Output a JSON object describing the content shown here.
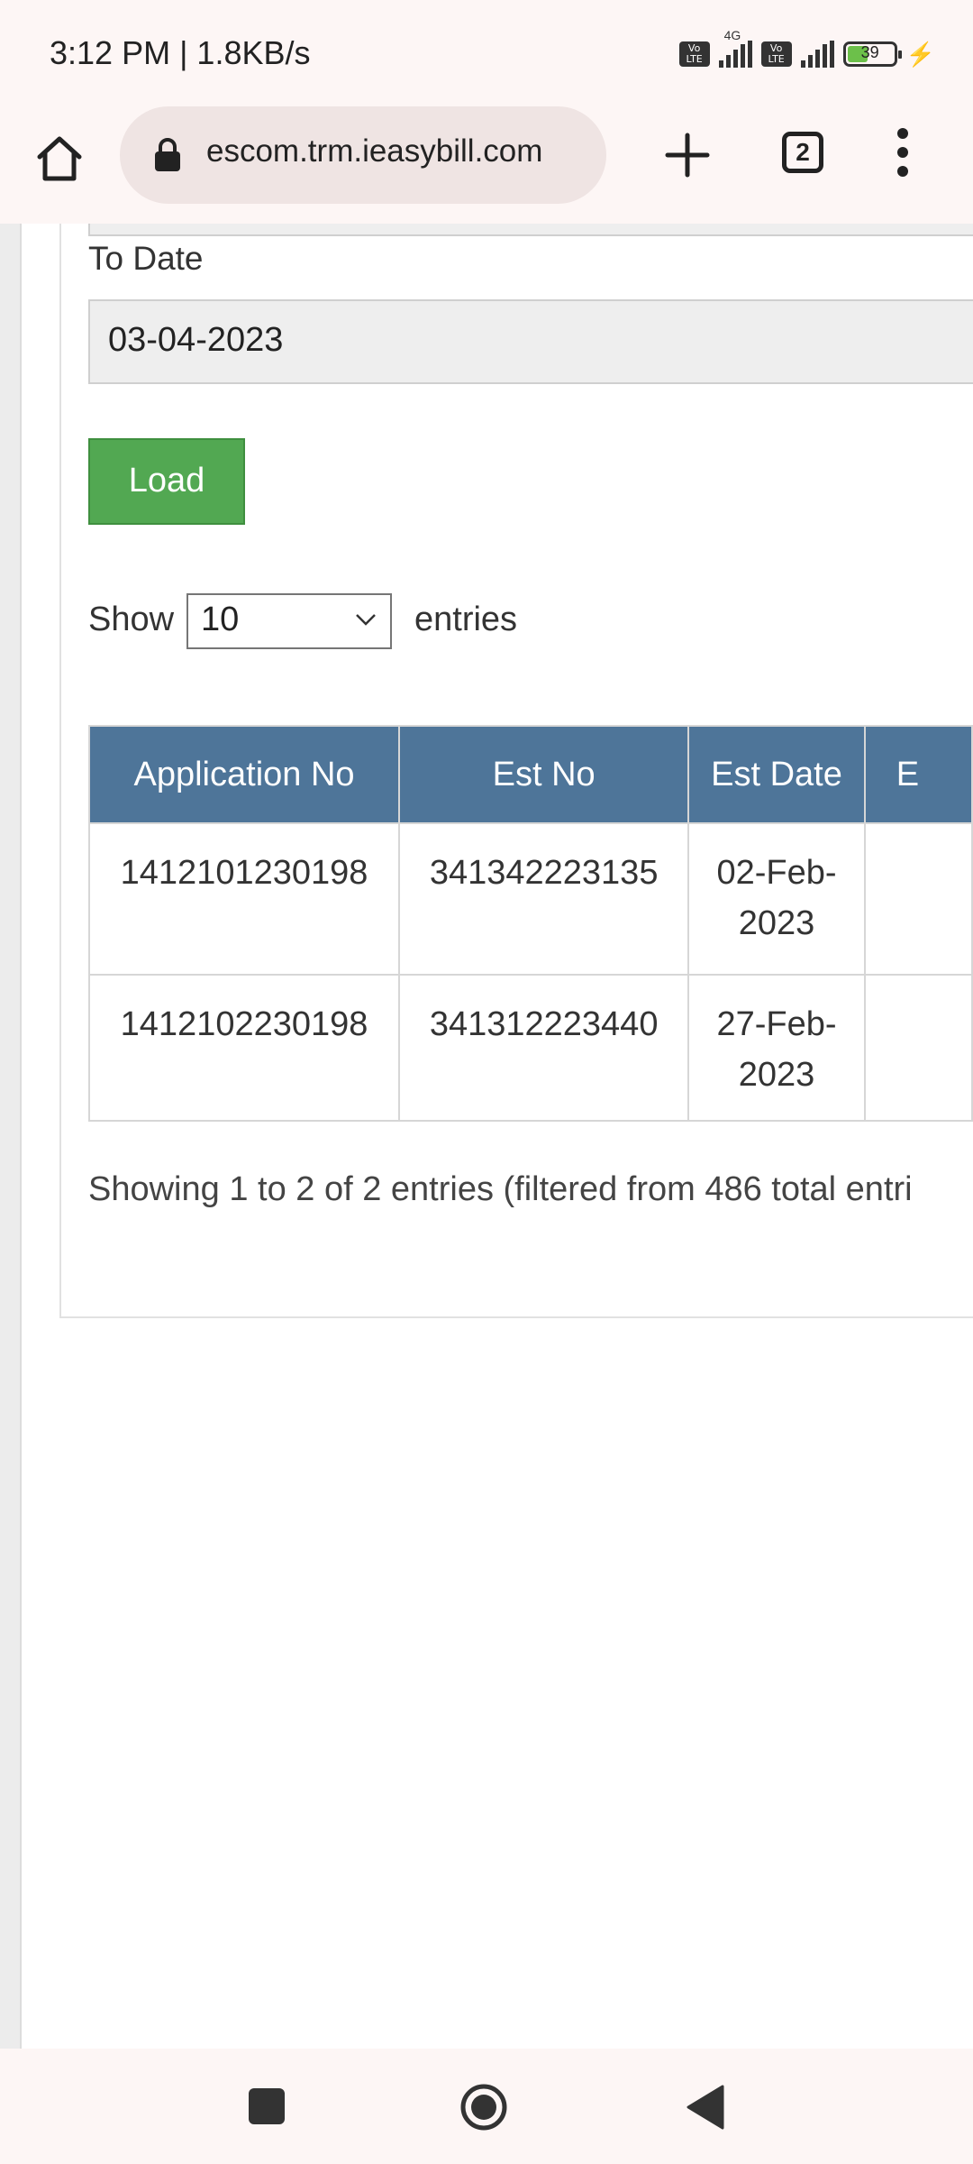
{
  "status_bar": {
    "time": "3:12 PM | 1.8KB/s",
    "network": "4G",
    "volte_label": "Vo LTE",
    "battery_percent": "39"
  },
  "browser": {
    "url": "escom.trm.ieasybill.com",
    "tab_count": "2"
  },
  "form": {
    "to_date_label": "To Date",
    "to_date_value": "03-04-2023",
    "load_label": "Load"
  },
  "table_controls": {
    "show_label": "Show",
    "page_size": "10",
    "entries_label": "entries"
  },
  "table": {
    "headers": [
      "Application No",
      "Est No",
      "Est Date",
      "E"
    ],
    "rows": [
      {
        "application_no": "1412101230198",
        "est_no": "341342223135",
        "est_date": "02-Feb-2023"
      },
      {
        "application_no": "1412102230198",
        "est_no": "341312223440",
        "est_date": "27-Feb-2023"
      }
    ],
    "info": "Showing 1 to 2 of 2 entries (filtered from 486 total entri"
  },
  "colors": {
    "header_bg": "#4e7599",
    "load_button": "#52a852",
    "chrome_bg": "#fdf6f5"
  }
}
